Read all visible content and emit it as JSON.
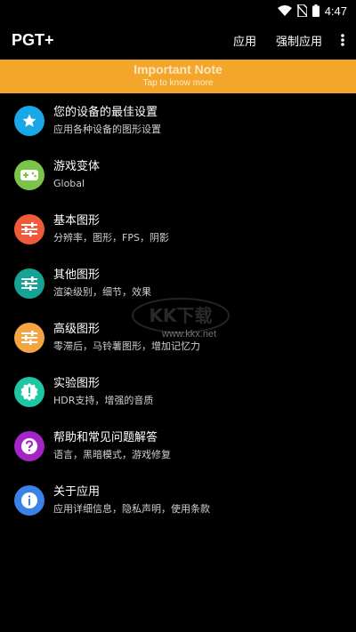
{
  "status_bar": {
    "time": "4:47"
  },
  "app_bar": {
    "title": "PGT+",
    "apply_label": "应用",
    "force_apply_label": "强制应用"
  },
  "banner": {
    "title": "Important Note",
    "subtitle": "Tap to know more",
    "color": "#f4a62a"
  },
  "menu": [
    {
      "title": "您的设备的最佳设置",
      "subtitle": "应用各种设备的图形设置",
      "icon": "star-icon",
      "color": "#1aa7e8"
    },
    {
      "title": "游戏变体",
      "subtitle": "Global",
      "icon": "gamepad-icon",
      "color": "#7cc34a"
    },
    {
      "title": "基本图形",
      "subtitle": "分辨率，图形，FPS，阴影",
      "icon": "sliders-icon",
      "color": "#f05a3a"
    },
    {
      "title": "其他图形",
      "subtitle": "渲染级别，细节，效果",
      "icon": "sliders-icon",
      "color": "#14a394"
    },
    {
      "title": "高级图形",
      "subtitle": "零滞后，马铃薯图形，增加记忆力",
      "icon": "sliders-icon",
      "color": "#f4a442"
    },
    {
      "title": "实验图形",
      "subtitle": "HDR支持，增强的音质",
      "icon": "alert-badge-icon",
      "color": "#1ec6a4"
    },
    {
      "title": "帮助和常见问题解答",
      "subtitle": "语言，黑暗模式，游戏修复",
      "icon": "help-icon",
      "color": "#a524c8"
    },
    {
      "title": "关于应用",
      "subtitle": "应用详细信息，隐私声明，使用条款",
      "icon": "info-icon",
      "color": "#3b82e8"
    }
  ],
  "watermark": {
    "text": "www.kkx.net"
  }
}
